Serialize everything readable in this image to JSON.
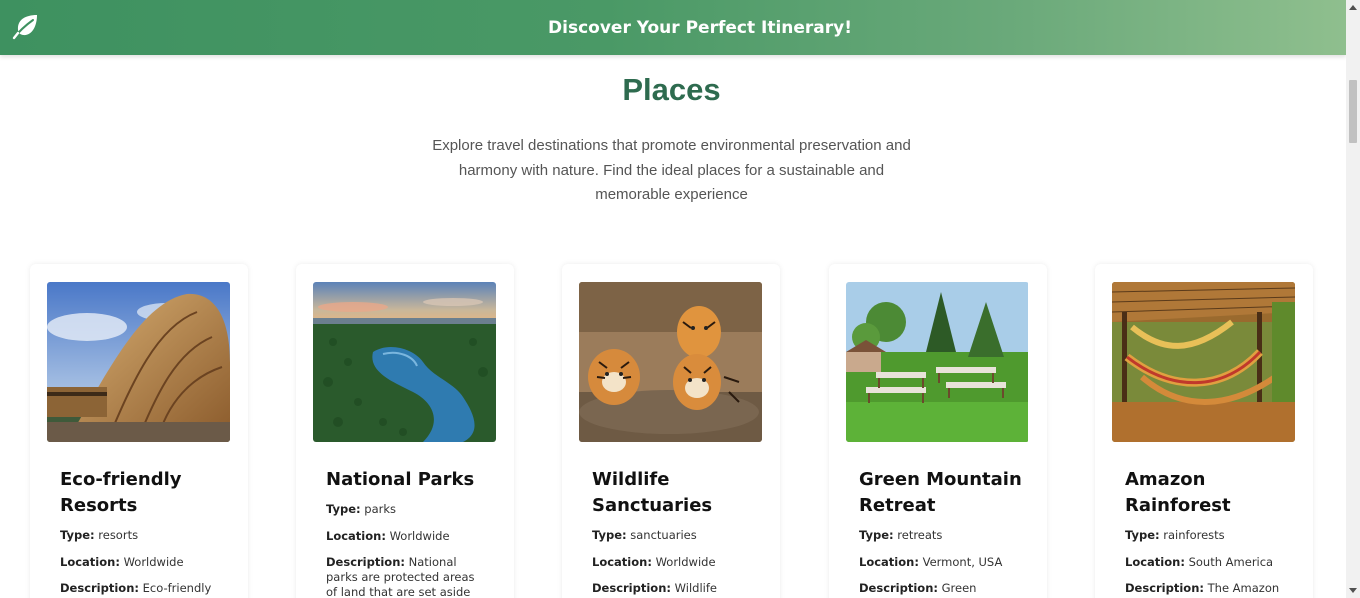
{
  "header": {
    "title": "Discover Your Perfect Itinerary!",
    "logo_icon": "leaf-icon"
  },
  "main": {
    "heading": "Places",
    "intro": "Explore travel destinations that promote environmental preservation and harmony with nature. Find the ideal places for a sustainable and memorable experience"
  },
  "labels": {
    "type": "Type:",
    "location": "Location:",
    "description": "Description:"
  },
  "places": [
    {
      "title": "Eco-friendly Resorts",
      "type": "resorts",
      "location": "Worldwide",
      "description": "Eco-friendly",
      "image_icon": "bamboo-resort-image"
    },
    {
      "title": "National Parks",
      "type": "parks",
      "location": "Worldwide",
      "description": "National parks are protected areas of land that are set aside for",
      "image_icon": "forest-lake-image"
    },
    {
      "title": "Wildlife Sanctuaries",
      "type": "sanctuaries",
      "location": "Worldwide",
      "description": "Wildlife",
      "image_icon": "tigers-image"
    },
    {
      "title": "Green Mountain Retreat",
      "type": "retreats",
      "location": "Vermont, USA",
      "description": "Green Mountain",
      "image_icon": "outdoor-dining-image"
    },
    {
      "title": "Amazon Rainforest",
      "type": "rainforests",
      "location": "South America",
      "description": "The Amazon",
      "image_icon": "hammocks-image"
    }
  ],
  "colors": {
    "header_gradient_start": "#3e9160",
    "header_gradient_end": "#8fbf8e",
    "heading": "#2e6b4f",
    "intro_text": "#555555"
  }
}
